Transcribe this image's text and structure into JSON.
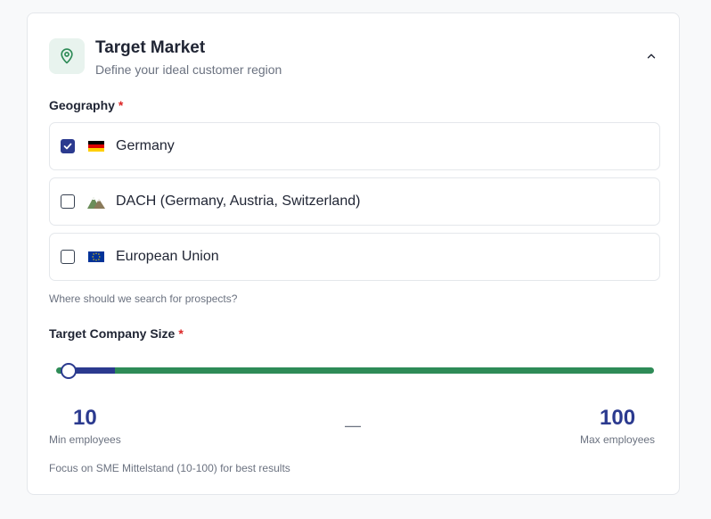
{
  "header": {
    "title": "Target Market",
    "subtitle": "Define your ideal customer region",
    "icon": "map-pin-icon",
    "collapse_icon": "chevron-up-icon"
  },
  "geography": {
    "label": "Geography",
    "required_mark": "*",
    "options": [
      {
        "label": "Germany",
        "flag": "🇩🇪",
        "checked": true
      },
      {
        "label": "DACH (Germany, Austria, Switzerland)",
        "flag": "⛰️",
        "checked": false
      },
      {
        "label": "European Union",
        "flag": "🇪🇺",
        "checked": false
      }
    ],
    "helper": "Where should we search for prospects?"
  },
  "company_size": {
    "label": "Target Company Size",
    "required_mark": "*",
    "min_value": "10",
    "max_value": "100",
    "min_label": "Min employees",
    "max_label": "Max employees",
    "separator": "—",
    "helper": "Focus on SME Mittelstand (10-100) for best results"
  },
  "colors": {
    "accent": "#2b3a8f",
    "green": "#2e8b57",
    "required": "#dc2626"
  }
}
